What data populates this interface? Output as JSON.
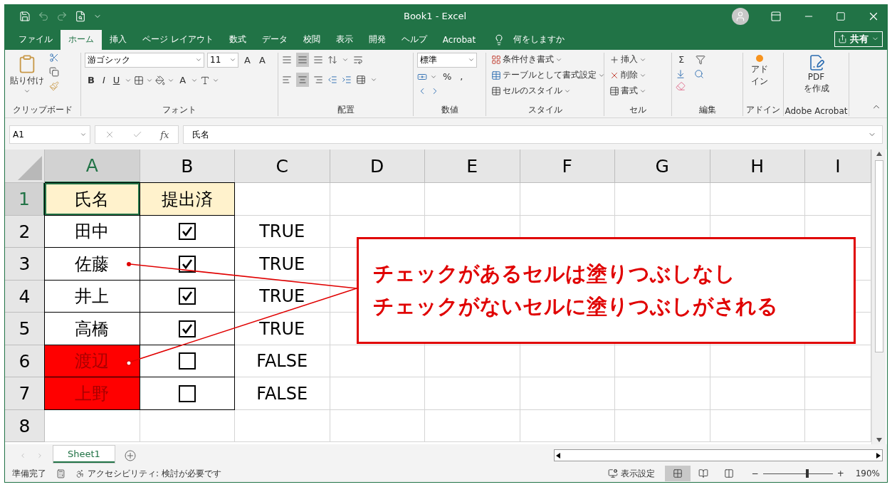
{
  "title_bar": {
    "title": "Book1  -  Excel"
  },
  "ribbon_tabs": [
    {
      "label": "ファイル",
      "selected": false
    },
    {
      "label": "ホーム",
      "selected": true
    },
    {
      "label": "挿入",
      "selected": false
    },
    {
      "label": "ページ レイアウト",
      "selected": false
    },
    {
      "label": "数式",
      "selected": false
    },
    {
      "label": "データ",
      "selected": false
    },
    {
      "label": "校閲",
      "selected": false
    },
    {
      "label": "表示",
      "selected": false
    },
    {
      "label": "開発",
      "selected": false
    },
    {
      "label": "ヘルプ",
      "selected": false
    },
    {
      "label": "Acrobat",
      "selected": false
    }
  ],
  "tell_me": "何をしますか",
  "share": "共有",
  "ribbon": {
    "clipboard": {
      "paste": "貼り付け",
      "label": "クリップボード"
    },
    "font": {
      "name": "游ゴシック",
      "size": "11",
      "grow": "A",
      "shrink": "A",
      "bold": "B",
      "italic": "I",
      "underline": "U",
      "font_color_letter": "A",
      "label": "フォント"
    },
    "alignment": {
      "label": "配置"
    },
    "number": {
      "format": "標準",
      "percent": "%",
      "comma": ",",
      "label": "数値"
    },
    "styles": {
      "items": [
        "条件付き書式",
        "テーブルとして書式設定",
        "セルのスタイル"
      ],
      "label": "スタイル"
    },
    "cells": {
      "items": [
        "挿入",
        "削除",
        "書式"
      ],
      "label": "セル"
    },
    "editing": {
      "sum": "Σ",
      "label": "編集"
    },
    "addins": {
      "button": "アドイン",
      "label": "アドイン"
    },
    "acrobat": {
      "button_lines": [
        "PDF",
        "を作成"
      ],
      "label": "Adobe Acrobat"
    }
  },
  "formula_bar": {
    "name_box": "A1",
    "fx": "fx",
    "value": "氏名"
  },
  "columns": [
    {
      "label": "A",
      "selected": true
    },
    {
      "label": "B",
      "selected": false
    },
    {
      "label": "C",
      "selected": false
    },
    {
      "label": "D",
      "selected": false
    },
    {
      "label": "E",
      "selected": false
    },
    {
      "label": "F",
      "selected": false
    },
    {
      "label": "G",
      "selected": false
    },
    {
      "label": "H",
      "selected": false
    },
    {
      "label": "I",
      "selected": false
    }
  ],
  "header_row": {
    "number": "1",
    "selected": true,
    "cells": [
      "氏名",
      "提出済"
    ]
  },
  "rows": [
    {
      "number": "2",
      "name": "田中",
      "checked": true,
      "result": "TRUE",
      "filled": false
    },
    {
      "number": "3",
      "name": "佐藤",
      "checked": true,
      "result": "TRUE",
      "filled": false
    },
    {
      "number": "4",
      "name": "井上",
      "checked": true,
      "result": "TRUE",
      "filled": false
    },
    {
      "number": "5",
      "name": "高橋",
      "checked": true,
      "result": "TRUE",
      "filled": false
    },
    {
      "number": "6",
      "name": "渡辺",
      "checked": false,
      "result": "FALSE",
      "filled": true
    },
    {
      "number": "7",
      "name": "上野",
      "checked": false,
      "result": "FALSE",
      "filled": true
    }
  ],
  "empty_rows": [
    "8"
  ],
  "callout": {
    "lines": [
      "チェックがあるセルは塗りつぶしなし",
      "チェックがないセルに塗りつぶしがされる"
    ]
  },
  "sheet_tabs": [
    {
      "label": "Sheet1",
      "selected": true
    }
  ],
  "status_bar": {
    "ready": "準備完了",
    "accessibility": "アクセシビリティ: 検討が必要です",
    "display_settings": "表示設定",
    "views": [
      {
        "kind": "normal",
        "selected": true
      },
      {
        "kind": "layout",
        "selected": false
      },
      {
        "kind": "pagebreak",
        "selected": false
      }
    ],
    "zoom": {
      "level": 0.64,
      "minus": "−",
      "plus": "+",
      "reading": "190%"
    }
  }
}
